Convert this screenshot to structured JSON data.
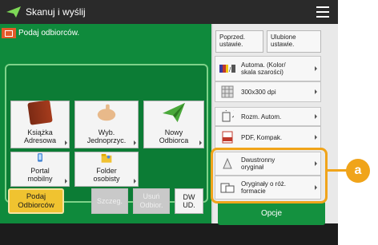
{
  "window": {
    "title": "Skanuj i wyślij"
  },
  "main": {
    "header": "Podaj odbiorców.",
    "tiles": [
      {
        "label": "Książka\nAdresowa",
        "icon": "address-book-icon"
      },
      {
        "label": "Wyb.\nJednoprzyc.",
        "icon": "one-touch-hand-icon"
      },
      {
        "label": "Nowy\nOdbiorca",
        "icon": "paper-plane-icon"
      },
      {
        "label": "Portal\nmobilny",
        "icon": "mobile-portal-icon"
      },
      {
        "label": "Folder\nosobisty",
        "icon": "personal-folder-icon"
      }
    ],
    "buttons": {
      "podaj": "Podaj\nOdbiorców",
      "szczeg": "Szczeg.",
      "usun": "Usuń\nOdbior.",
      "dwud": "DW\nUD."
    }
  },
  "right": {
    "top_buttons": {
      "previous": "Poprzed.\nustawie.",
      "favorite": "Ulubione\nustawie."
    },
    "settings": [
      {
        "label": "Automa. (Kolor/\nskala szarości)",
        "icon": "color-mode-icon"
      },
      {
        "label": "300x300 dpi",
        "icon": "resolution-icon"
      },
      {
        "label": "Rozm. Autom.",
        "icon": "scan-size-icon"
      },
      {
        "label": "PDF, Kompak.",
        "icon": "pdf-file-icon"
      },
      {
        "label": "Dwustronny\noryginał",
        "icon": "two-sided-original-icon"
      },
      {
        "label": "Oryginały o róż.\nformacie",
        "icon": "mixed-size-originals-icon"
      }
    ],
    "options": "Opcje"
  },
  "callout": "a",
  "colors": {
    "accent_green": "#0f8a3c",
    "highlight": "#f0a41a",
    "primary_button": "#f0c330"
  }
}
